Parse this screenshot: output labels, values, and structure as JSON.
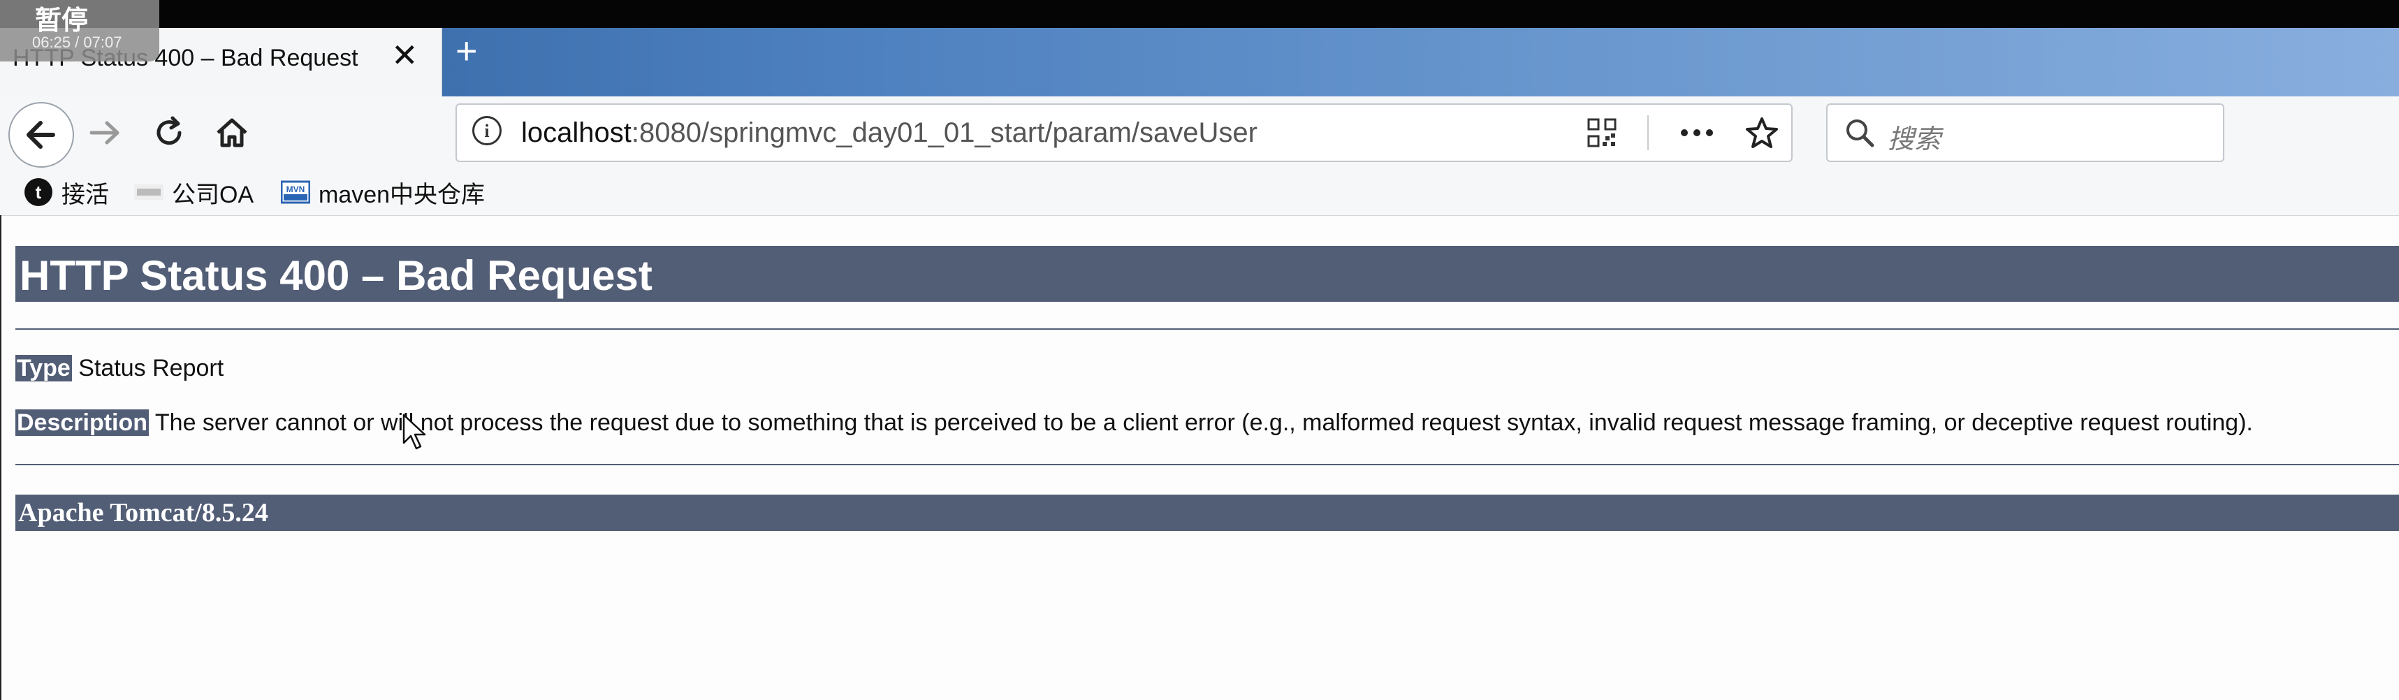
{
  "video_overlay": {
    "status": "暂停",
    "time": "06:25 / 07:07"
  },
  "tab": {
    "title": "HTTP Status 400 – Bad Request"
  },
  "address_bar": {
    "host": "localhost",
    "path": ":8080/springmvc_day01_01_start/param/saveUser"
  },
  "search": {
    "placeholder": "搜索"
  },
  "bookmarks": [
    {
      "label": "接活"
    },
    {
      "label": "公司OA"
    },
    {
      "label": "maven中央仓库"
    }
  ],
  "page": {
    "heading": "HTTP Status 400 – Bad Request",
    "type_label": "Type",
    "type_value": "Status Report",
    "description_label": "Description",
    "description_value": "The server cannot or will not process the request due to something that is perceived to be a client error (e.g., malformed request syntax, invalid request message framing, or deceptive request routing).",
    "footer": "Apache Tomcat/8.5.24"
  },
  "colors": {
    "accent": "#525d76",
    "chrome": "#f6f7f8"
  }
}
